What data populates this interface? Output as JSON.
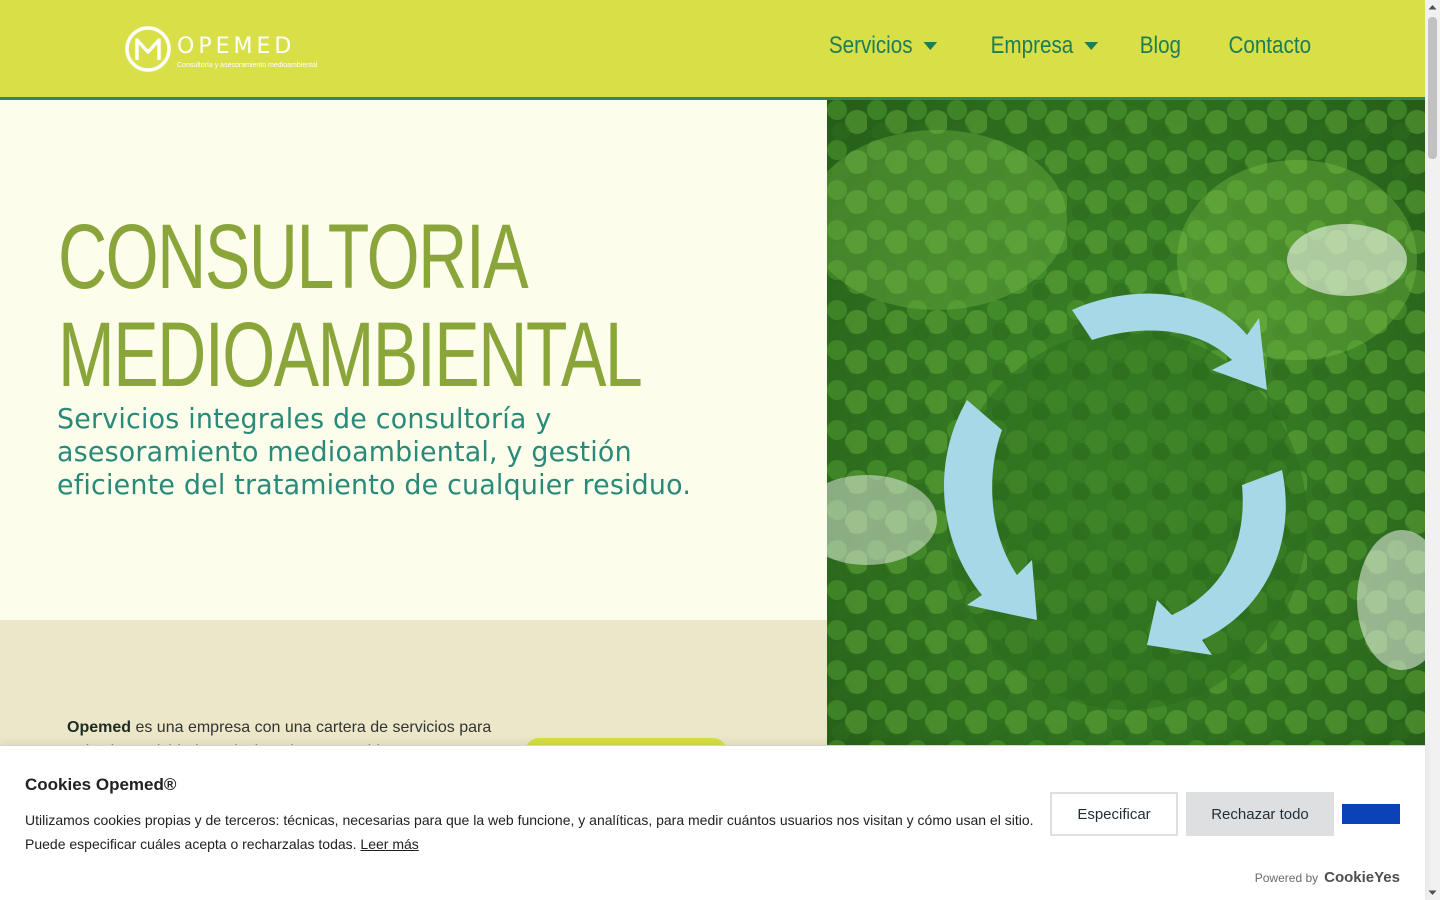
{
  "header": {
    "logo": {
      "name": "OPEMED",
      "tagline": "Consultoría y asesoramiento medioambiental"
    },
    "nav": [
      {
        "label": "Servicios",
        "has_dropdown": true,
        "icon": "caret-down-icon"
      },
      {
        "label": "Empresa",
        "has_dropdown": true,
        "icon": "caret-down-icon"
      },
      {
        "label": "Blog",
        "has_dropdown": false
      },
      {
        "label": "Contacto",
        "has_dropdown": false
      }
    ]
  },
  "hero": {
    "title_line1": "CONSULTORIA",
    "title_line2": "MEDIOAMBIENTAL",
    "subtitle": "Servicios integrales de consultoría y asesoramiento medioambiental, y gestión eficiente del tratamiento de cualquier residuo."
  },
  "intro": {
    "brand": "Opemed",
    "text": " es una empresa con una cartera de servicios para todas las actividades relacionadas con residuos y"
  },
  "cookie": {
    "title": "Cookies Opemed®",
    "text": "Utilizamos cookies propias y de terceros: técnicas, necesarias para que la web funcione, y analíticas, para medir cuántos usuarios nos visitan y cómo usan el sitio. Puede especificar cuáles acepta o recharzalas todas.",
    "read_more": "Leer más",
    "btn_customize": "Especificar",
    "btn_reject": "Rechazar todo",
    "powered_by": "Powered by",
    "powered_brand": "CookieYes"
  },
  "colors": {
    "header_bg": "#d8df47",
    "nav_text": "#1f7d55",
    "hero_title": "#8aa63a",
    "hero_sub": "#2a8a7a",
    "accept_btn": "#0b42b5"
  }
}
